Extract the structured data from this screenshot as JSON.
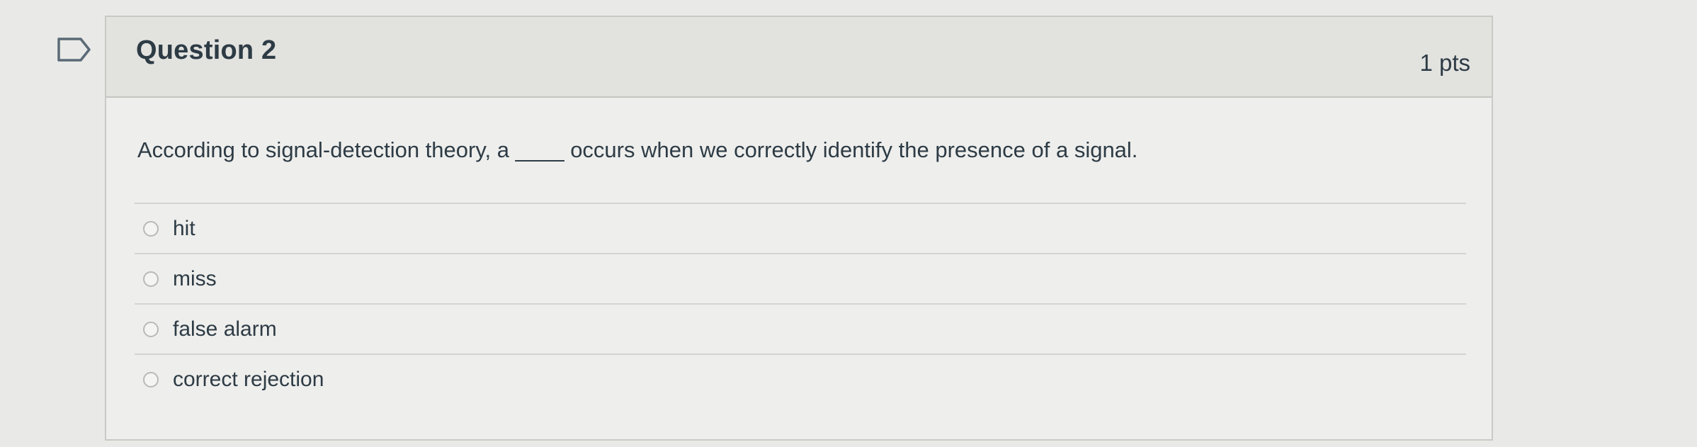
{
  "question": {
    "title": "Question 2",
    "points": "1 pts",
    "text": "According to signal-detection theory, a ____ occurs when we correctly identify the presence of a signal.",
    "answers": [
      {
        "label": "hit"
      },
      {
        "label": "miss"
      },
      {
        "label": "false alarm"
      },
      {
        "label": "correct rejection"
      }
    ]
  },
  "icons": {
    "flag": "flag-icon",
    "radio": "radio-unselected"
  },
  "colors": {
    "text": "#2d3b45",
    "header_bg": "#e2e2df",
    "card_bg": "#eeeeec",
    "border": "#c9c9c6"
  }
}
